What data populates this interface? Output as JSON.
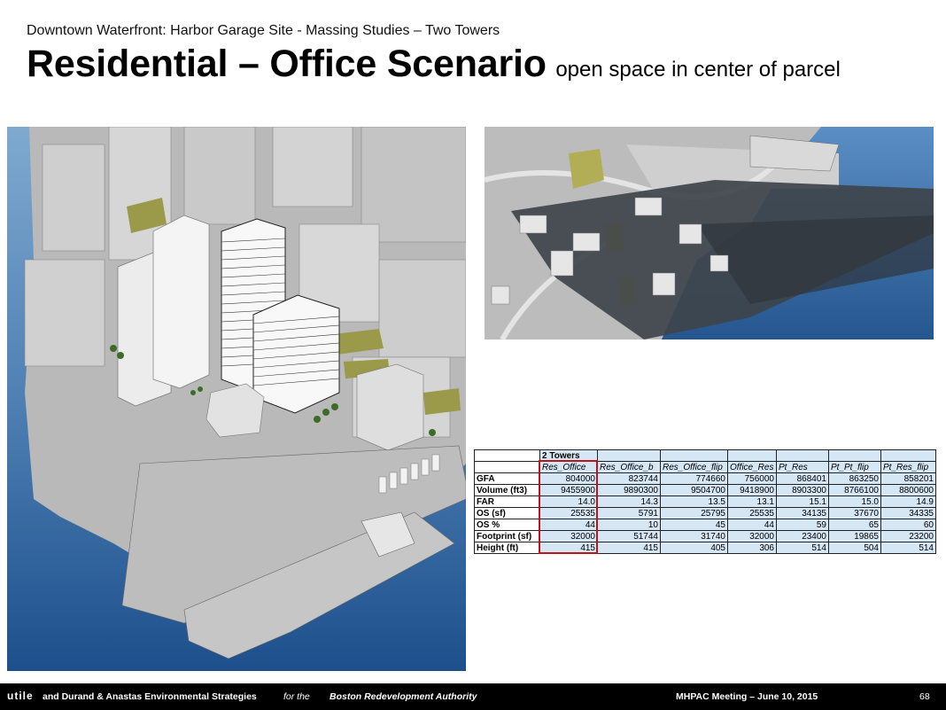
{
  "header": {
    "supertitle": "Downtown Waterfront: Harbor Garage Site - Massing Studies – Two Towers",
    "title": "Residential – Office Scenario",
    "subtitle": "open space in center of parcel"
  },
  "images": {
    "left": "aerial-massing-render",
    "right": "shadow-study-plan"
  },
  "table": {
    "group_label": "2 Towers",
    "columns": [
      "Res_Office",
      "Res_Office_b",
      "Res_Office_flip",
      "Office_Res",
      "Pt_Res",
      "Pt_Pt_flip",
      "Pt_Res_flip"
    ],
    "highlighted_column": "Res_Office",
    "rows": [
      {
        "label": "GFA",
        "values": [
          "804000",
          "823744",
          "774660",
          "756000",
          "868401",
          "863250",
          "858201"
        ]
      },
      {
        "label": "Volume (ft3)",
        "values": [
          "9455900",
          "9890300",
          "9504700",
          "9418900",
          "8903300",
          "8766100",
          "8800600"
        ]
      },
      {
        "label": "FAR",
        "values": [
          "14.0",
          "14.3",
          "13.5",
          "13.1",
          "15.1",
          "15.0",
          "14.9"
        ]
      },
      {
        "label": "OS (sf)",
        "values": [
          "25535",
          "5791",
          "25795",
          "25535",
          "34135",
          "37670",
          "34335"
        ]
      },
      {
        "label": "OS %",
        "values": [
          "44",
          "10",
          "45",
          "44",
          "59",
          "65",
          "60"
        ]
      },
      {
        "label": "Footprint (sf)",
        "values": [
          "32000",
          "51744",
          "31740",
          "32000",
          "23400",
          "19865",
          "23200"
        ]
      },
      {
        "label": "Height (ft)",
        "values": [
          "415",
          "415",
          "405",
          "306",
          "514",
          "504",
          "514"
        ]
      }
    ]
  },
  "footer": {
    "logo": "utile",
    "credit": "and Durand & Anastas Environmental Strategies",
    "for_text": "for the",
    "client": "Boston Redevelopment Authority",
    "meeting": "MHPAC Meeting  – June 10, 2015",
    "page": "68"
  },
  "colors": {
    "water_top": "#6f9ec6",
    "water_bottom": "#1c4f8c",
    "highlight": "#c0141c",
    "table_fill": "#d5e6f5",
    "footer_bg": "#000000"
  }
}
